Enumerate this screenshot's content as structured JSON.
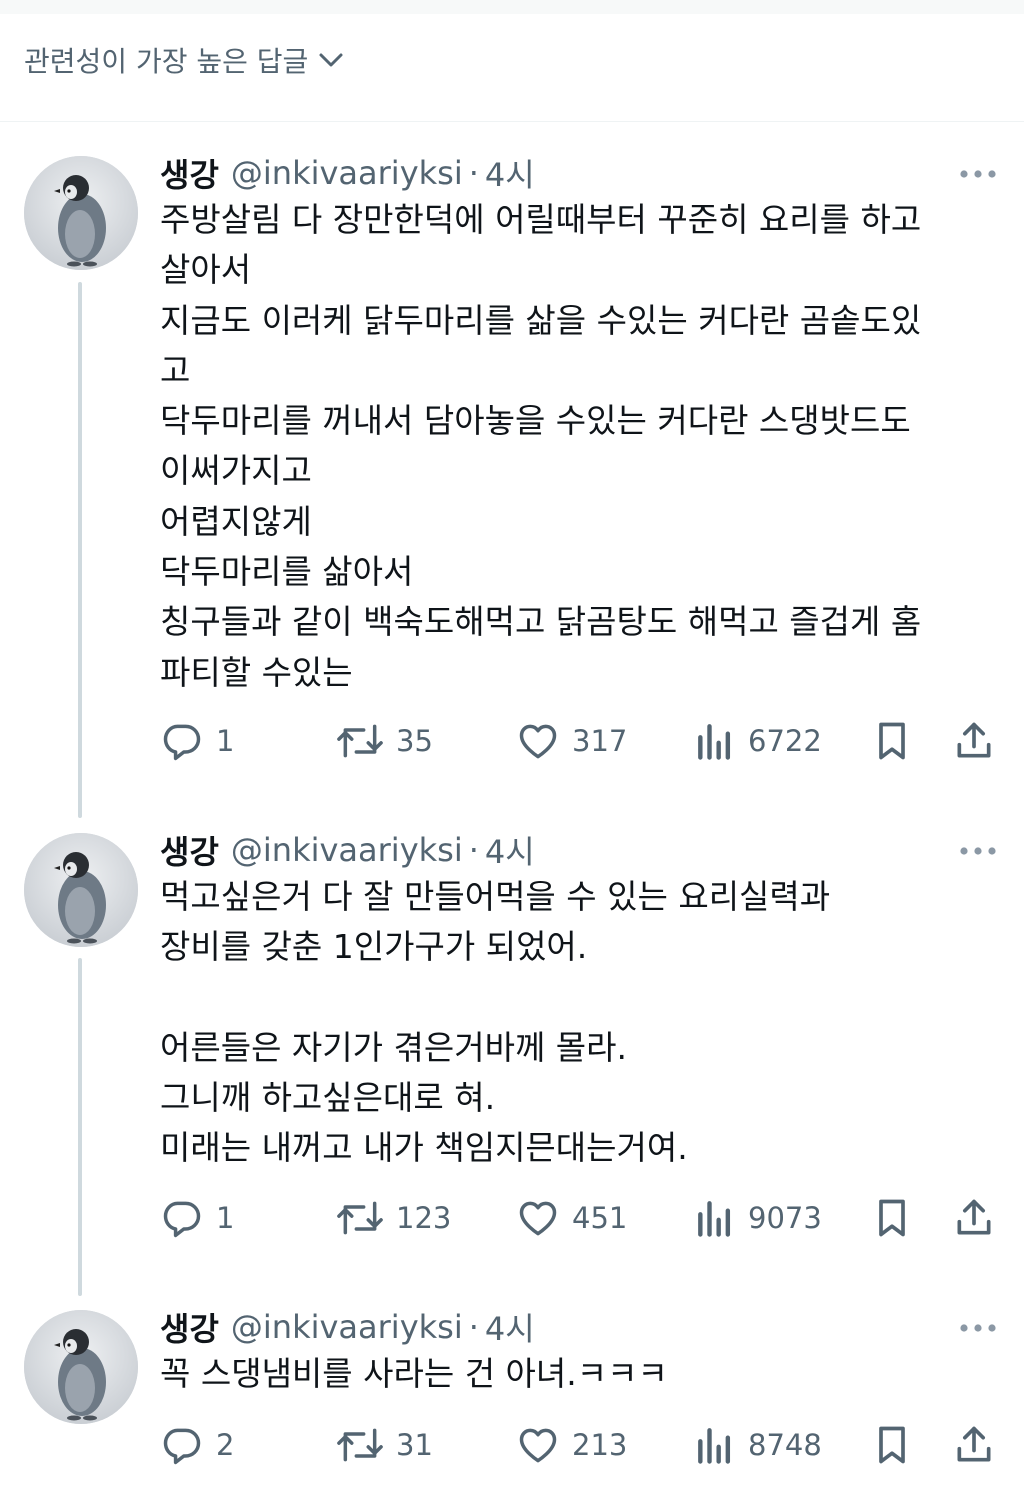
{
  "sort": {
    "label": "관련성이 가장 높은 답글"
  },
  "tweets": [
    {
      "name": "생강",
      "handle": "@inkivaariyksi",
      "dot": "·",
      "time": "4시",
      "text": "주방살림 다 장만한덕에 어릴때부터 꾸준히 요리를 하고\n살아서\n지금도 이러케 닭두마리를 삶을 수있는 커다란 곰솥도있\n고\n닥두마리를 꺼내서 담아놓을 수있는 커다란 스댕밧드도\n이써가지고\n어렵지않게\n닥두마리를 삶아서\n칭구들과 같이 백숙도해먹고 닭곰탕도 해먹고 즐겁게 홈\n파티할 수있는",
      "replies": "1",
      "retweets": "35",
      "likes": "317",
      "views": "6722"
    },
    {
      "name": "생강",
      "handle": "@inkivaariyksi",
      "dot": "·",
      "time": "4시",
      "text": "먹고싶은거 다 잘 만들어먹을 수 있는 요리실력과\n장비를 갖춘 1인가구가 되었어.\n\n어른들은 자기가 겪은거바께 몰라.\n그니깨 하고싶은대로 혀.\n미래는 내꺼고 내가 책임지믄대는거여.",
      "replies": "1",
      "retweets": "123",
      "likes": "451",
      "views": "9073"
    },
    {
      "name": "생강",
      "handle": "@inkivaariyksi",
      "dot": "·",
      "time": "4시",
      "text": "꼭 스댕냄비를 사라는 건 아녀.ㅋㅋㅋ",
      "replies": "2",
      "retweets": "31",
      "likes": "213",
      "views": "8748"
    }
  ],
  "icons": {
    "reply": "reply-icon",
    "retweet": "retweet-icon",
    "like": "heart-icon",
    "views": "views-icon",
    "bookmark": "bookmark-icon",
    "share": "share-icon",
    "more": "more-icon"
  },
  "colors": {
    "text": "#0f1419",
    "secondary": "#536471",
    "thread": "#cfd9de",
    "divider": "#eff3f4"
  }
}
